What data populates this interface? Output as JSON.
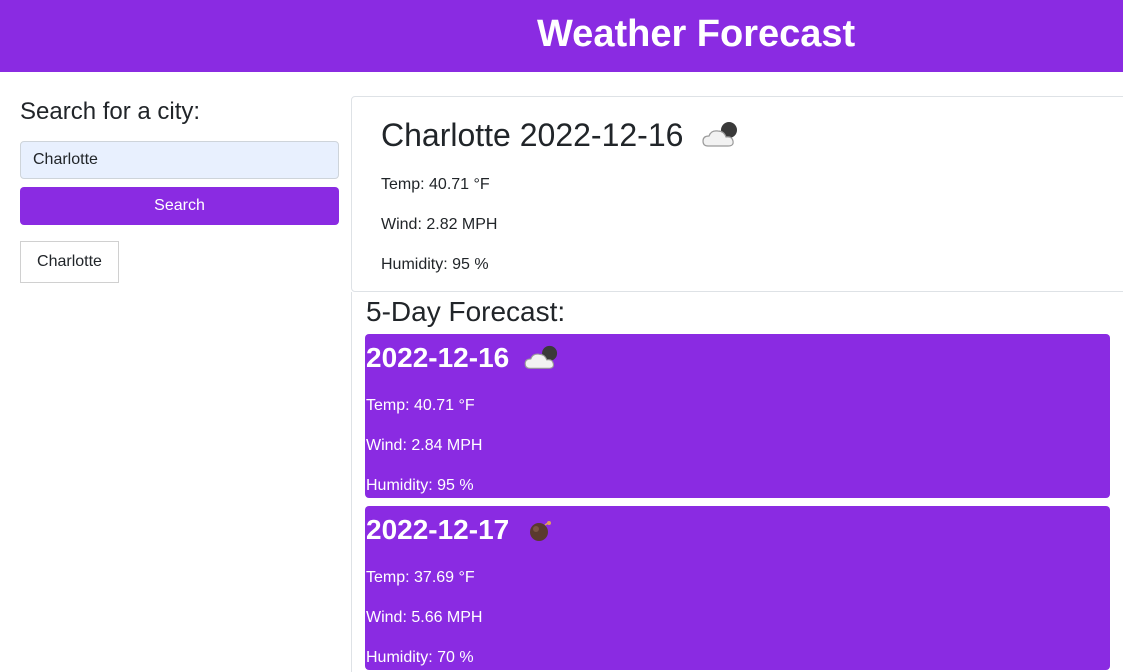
{
  "header": {
    "title": "Weather Forecast"
  },
  "search": {
    "heading": "Search for a city:",
    "input_value": "Charlotte",
    "button_label": "Search"
  },
  "history": [
    "Charlotte"
  ],
  "today": {
    "title": "Charlotte 2022-12-16",
    "icon": "partly-cloudy-night-icon",
    "temp": "Temp: 40.71 °F",
    "wind": "Wind: 2.82 MPH",
    "humidity": "Humidity: 95 %"
  },
  "forecast": {
    "heading": "5-Day Forecast:",
    "days": [
      {
        "date": "2022-12-16",
        "icon": "partly-cloudy-night-icon",
        "temp": "Temp: 40.71 °F",
        "wind": "Wind: 2.84 MPH",
        "humidity": "Humidity: 95 %"
      },
      {
        "date": "2022-12-17",
        "icon": "dark-orb-icon",
        "temp": "Temp: 37.69 °F",
        "wind": "Wind: 5.66 MPH",
        "humidity": "Humidity: 70 %"
      }
    ]
  },
  "colors": {
    "accent": "#8a2be2",
    "input_bg": "#e8f0fe"
  }
}
